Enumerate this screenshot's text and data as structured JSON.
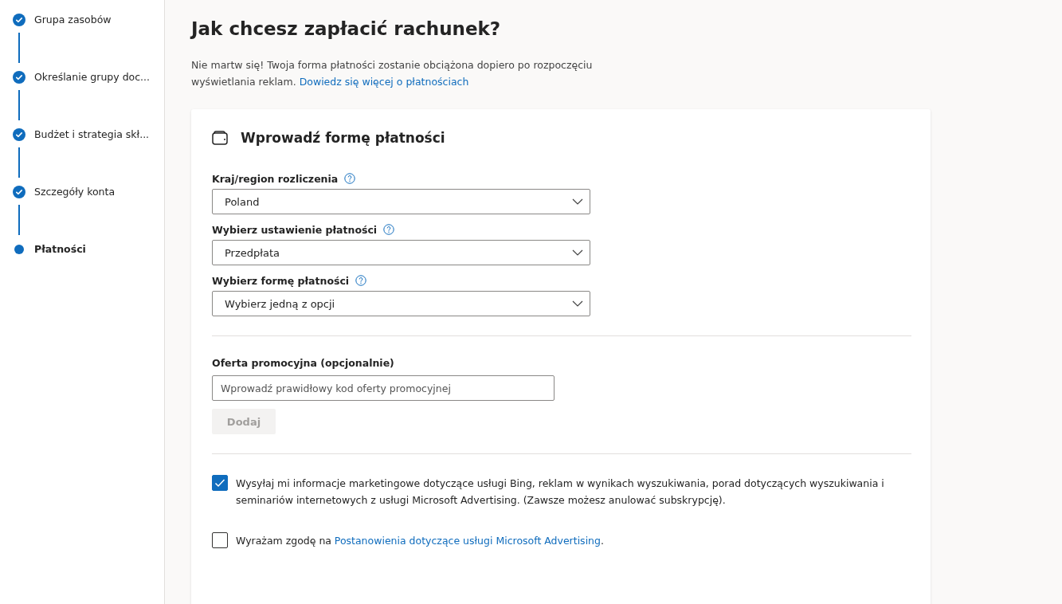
{
  "steps": [
    {
      "label": "Grupa zasobów",
      "completed": true,
      "selected": false
    },
    {
      "label": "Określanie grupy doc...",
      "completed": true,
      "selected": false
    },
    {
      "label": "Budżet i strategia skł...",
      "completed": true,
      "selected": false
    },
    {
      "label": "Szczegóły konta",
      "completed": true,
      "selected": false
    },
    {
      "label": "Płatności",
      "completed": false,
      "selected": true
    }
  ],
  "page": {
    "title": "Jak chcesz zapłacić rachunek?",
    "description": "Nie martw się! Twoja forma płatności zostanie obciążona dopiero po rozpoczęciu wyświetlania reklam.",
    "description_link": "Dowiedz się więcej o płatnościach"
  },
  "card": {
    "title": "Wprowadź formę płatności",
    "dropdowns": [
      {
        "label": "Kraj/region rozliczenia",
        "value": "Poland"
      },
      {
        "label": "Wybierz ustawienie płatności",
        "value": "Przedpłata"
      },
      {
        "label": "Wybierz formę płatności",
        "value": "Wybierz jedną z opcji"
      }
    ],
    "promo": {
      "label": "Oferta promocyjna (opcjonalnie)",
      "placeholder": "Wprowadź prawidłowy kod oferty promocyjnej",
      "button": "Dodaj",
      "button_disabled": true
    },
    "checkboxes": [
      {
        "text": "Wysyłaj mi informacje marketingowe dotyczące usługi Bing, reklam w wynikach wyszukiwania, porad dotyczących wyszukiwania i seminariów internetowych z usługi Microsoft Advertising. (Zawsze możesz anulować subskrypcję).",
        "checked": true
      },
      {
        "text": "Wyrażam zgodę na",
        "link": "Postanowienia dotyczące usługi Microsoft Advertising",
        "after": ".",
        "checked": false
      }
    ]
  }
}
